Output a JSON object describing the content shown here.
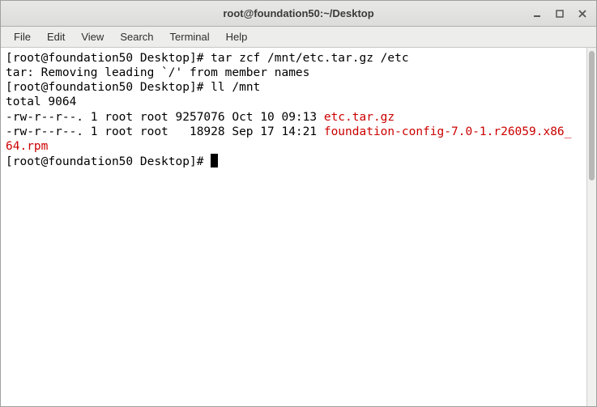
{
  "window": {
    "title": "root@foundation50:~/Desktop"
  },
  "menu": {
    "file": "File",
    "edit": "Edit",
    "view": "View",
    "search": "Search",
    "terminal": "Terminal",
    "help": "Help"
  },
  "term": {
    "prompt": "[root@foundation50 Desktop]# ",
    "cmd1": "tar zcf /mnt/etc.tar.gz /etc",
    "out1": "tar: Removing leading `/' from member names",
    "cmd2": "ll /mnt",
    "out2": "total 9064",
    "ls1_perm": "-rw-r--r--. 1 root root 9257076 Oct 10 09:13 ",
    "ls1_name": "etc.tar.gz",
    "ls2_perm": "-rw-r--r--. 1 root root   18928 Sep 17 14:21 ",
    "ls2_name_a": "foundation-config-7.0-1.r26059.x86_",
    "ls2_name_b": "64.rpm"
  }
}
